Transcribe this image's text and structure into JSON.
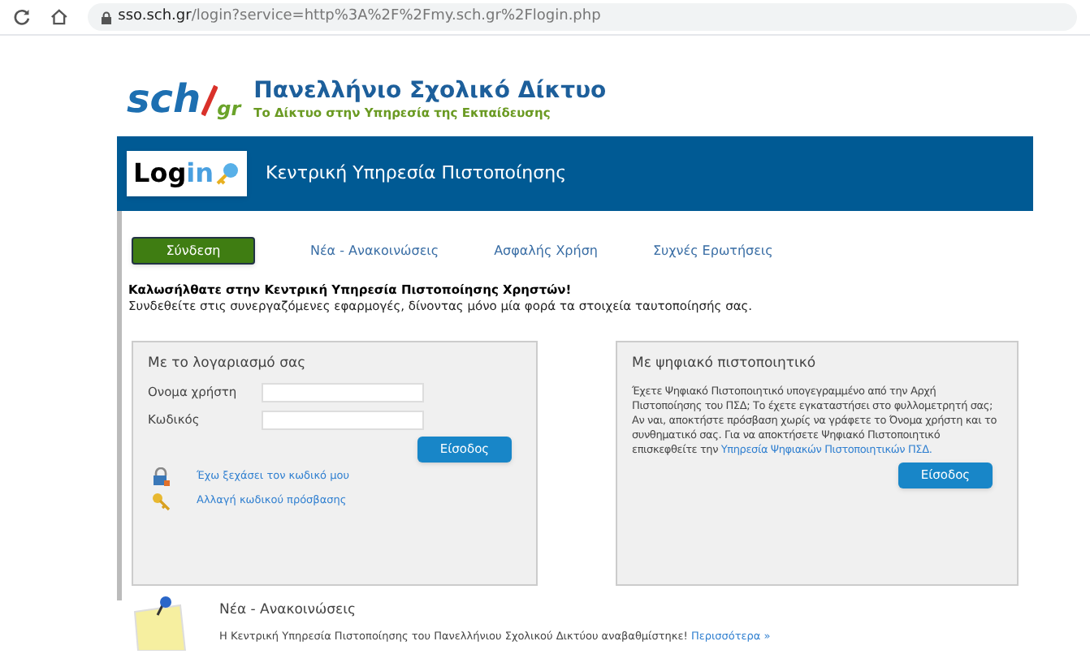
{
  "browser": {
    "url_host": "sso.sch.gr",
    "url_path": "/login?service=http%3A%2F%2Fmy.sch.gr%2Flogin.php"
  },
  "logo": {
    "text": "sch",
    "suffix": "gr",
    "title": "Πανελλήνιο Σχολικό Δίκτυο",
    "subtitle": "Το Δίκτυο στην Υπηρεσία της Εκπαίδευσης"
  },
  "header": {
    "badge_text": "Log",
    "badge_accent": "in",
    "title": "Κεντρική Υπηρεσία Πιστοποίησης"
  },
  "tabs": [
    {
      "label": "Σύνδεση",
      "selected": true
    },
    {
      "label": "Νέα - Ανακοινώσεις",
      "selected": false
    },
    {
      "label": "Ασφαλής Χρήση",
      "selected": false
    },
    {
      "label": "Συχνές Ερωτήσεις",
      "selected": false
    }
  ],
  "welcome": {
    "title": "Καλωσήλθατε στην Κεντρική Υπηρεσία Πιστοποίησης Χρηστών!",
    "text": "Συνδεθείτε στις συνεργαζόμενες εφαρμογές, δίνοντας μόνο μία φορά τα στοιχεία ταυτοποίησής σας."
  },
  "account_panel": {
    "title": "Με το λογαριασμό σας",
    "fields": [
      {
        "label": "Ονομα χρήστη"
      },
      {
        "label": "Κωδικός"
      }
    ],
    "button": "Είσοδος",
    "links": [
      {
        "label": "Έχω ξεχάσει τον κωδικό μου",
        "kind": "lock"
      },
      {
        "label": "Αλλαγή κωδικού πρόσβασης",
        "kind": "key"
      }
    ]
  },
  "certificate_panel": {
    "title": "Με ψηφιακό πιστοποιητικό",
    "text": "Έχετε Ψηφιακό Πιστοποιητικό υπογεγραμμένο από την Αρχή Πιστοποίησης του ΠΣΔ; Το έχετε εγκαταστήσει στο φυλλομετρητή σας; Αν ναι, αποκτήστε πρόσβαση χωρίς να γράφετε το Όνομα χρήστη και το συνθηματικό σας. Για να αποκτήσετε Ψηφιακό Πιστοποιητικό επισκεφθείτε την",
    "link": "Υπηρεσία Ψηφιακών Πιστοποιητικών ΠΣΔ.",
    "button": "Είσοδος"
  },
  "news": {
    "title": "Νέα - Ανακοινώσεις",
    "text": "Η Κεντρική Υπηρεσία Πιστοποίησης του Πανελλήνιου Σχολικού Δικτύου αναβαθμίστηκε!",
    "link": "Περισσότερα »"
  }
}
